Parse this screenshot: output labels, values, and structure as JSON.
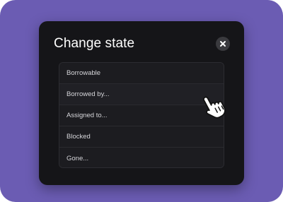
{
  "dialog": {
    "title": "Change state",
    "close_icon": "close-icon"
  },
  "states": [
    {
      "label": "Borrowable"
    },
    {
      "label": "Borrowed by..."
    },
    {
      "label": "Assigned to..."
    },
    {
      "label": "Blocked"
    },
    {
      "label": "Gone..."
    }
  ],
  "colors": {
    "background": "#6b5cb3",
    "dialog": "#151518",
    "list": "#1c1c20",
    "text": "#ffffff"
  },
  "cursor": {
    "icon": "hand-pointer-icon",
    "hovered_item": "Borrowed by..."
  }
}
